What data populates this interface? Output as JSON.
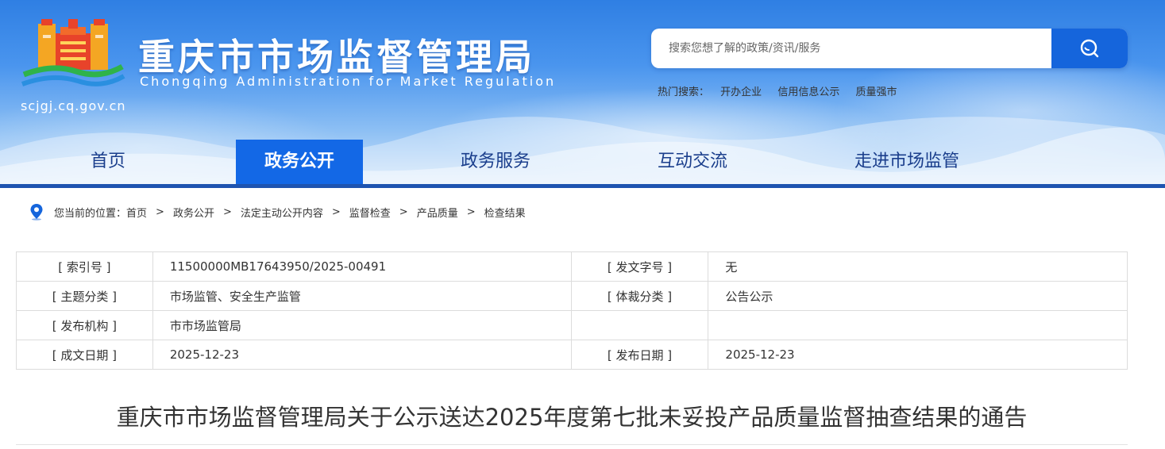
{
  "header": {
    "site_title": "重庆市市场监督管理局",
    "site_subtitle": "Chongqing  Administration for Market Regulation",
    "domain": "scjgj.cq.gov.cn",
    "logo_icon": "cq-amr-emblem-icon",
    "search": {
      "placeholder": "搜索您想了解的政策/资讯/服务",
      "button_icon": "search-icon"
    },
    "hot_search": {
      "label": "热门搜索：",
      "items": [
        "开办企业",
        "信用信息公示",
        "质量强市"
      ]
    }
  },
  "nav": {
    "items": [
      {
        "label": "首页"
      },
      {
        "label": "政务公开"
      },
      {
        "label": "政务服务"
      },
      {
        "label": "互动交流"
      },
      {
        "label": "走进市场监管"
      }
    ],
    "active_index": 1
  },
  "breadcrumb": {
    "icon": "location-pin-icon",
    "prefix": "您当前的位置：",
    "items": [
      "首页",
      "政务公开",
      "法定主动公开内容",
      "监督检查",
      "产品质量",
      "检查结果"
    ],
    "separator": ">"
  },
  "info_table": {
    "rows": [
      {
        "k1": "[ 索引号 ]",
        "v1": "11500000MB17643950/2025-00491",
        "k2": "[ 发文字号 ]",
        "v2": "无"
      },
      {
        "k1": "[ 主题分类 ]",
        "v1": "市场监管、安全生产监管",
        "k2": "[ 体裁分类 ]",
        "v2": "公告公示"
      },
      {
        "k1": "[ 发布机构 ]",
        "v1": "市市场监管局",
        "k2": "",
        "v2": ""
      },
      {
        "k1": "[ 成文日期 ]",
        "v1": "2025-12-23",
        "k2": "[ 发布日期 ]",
        "v2": "2025-12-23"
      }
    ]
  },
  "article": {
    "title": "重庆市市场监督管理局关于公示送达2025年度第七批未妥投产品质量监督抽查结果的通告"
  },
  "colors": {
    "header_blue": "#2f7fe3",
    "nav_active_bg": "#1368e6",
    "nav_active_underline": "#e02424",
    "nav_text": "#1a3e8c",
    "search_button": "#1565dc"
  }
}
